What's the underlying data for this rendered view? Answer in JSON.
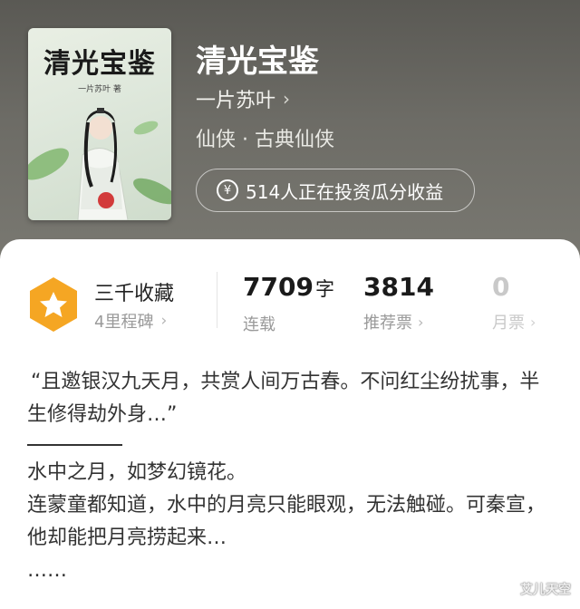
{
  "book": {
    "cover_title": "清光宝鉴",
    "cover_author": "一片苏叶 著",
    "title": "清光宝鉴",
    "author": "一片苏叶",
    "genre": "仙侠 · 古典仙侠",
    "invest_text": "514人正在投资瓜分收益"
  },
  "stats": {
    "milestone_title": "三千收藏",
    "milestone_sub": "4里程碑",
    "word_count": "7709",
    "word_unit": "字",
    "status": "连载",
    "recommend_value": "3814",
    "recommend_label": "推荐票",
    "monthly_value": "0",
    "monthly_label": "月票"
  },
  "synopsis": {
    "quote": "“且邀银汉九天月，共赏人间万古春。不问红尘纷扰事，半生修得劫外身…”",
    "line1": "水中之月，如梦幻镜花。",
    "line2": "连蒙童都知道，水中的月亮只能眼观，无法触碰。可秦宣，他却能把月亮捞起来…",
    "ellipsis": "……"
  },
  "watermark": "艾儿天空",
  "colors": {
    "badge_orange": "#f5a623",
    "hero_bg": "#6b6a64",
    "text_muted": "#9a9a9a"
  }
}
